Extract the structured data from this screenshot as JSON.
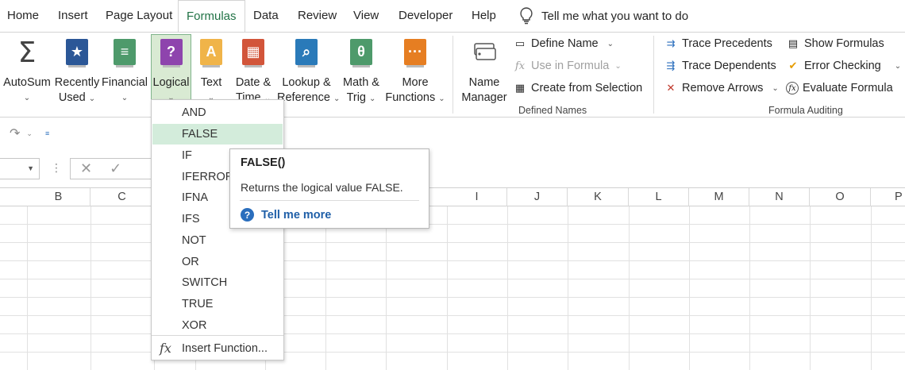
{
  "tabs": [
    "Home",
    "Insert",
    "Page Layout",
    "Formulas",
    "Data",
    "Review",
    "View",
    "Developer",
    "Help"
  ],
  "active_tab": "Formulas",
  "tell_me": "Tell me what you want to do",
  "ribbon": {
    "autosum": "AutoSum",
    "recently_used": [
      "Recently",
      "Used"
    ],
    "financial": "Financial",
    "logical": "Logical",
    "text": "Text",
    "datetime": [
      "Date &",
      "Time"
    ],
    "lookup": [
      "Lookup &",
      "Reference"
    ],
    "math": [
      "Math &",
      "Trig"
    ],
    "more": [
      "More",
      "Functions"
    ],
    "name_manager": [
      "Name",
      "Manager"
    ],
    "define_name": "Define Name",
    "use_in_formula": "Use in Formula",
    "create_from_selection": "Create from Selection",
    "defined_names_group": "Defined Names",
    "trace_precedents": "Trace Precedents",
    "trace_dependents": "Trace Dependents",
    "remove_arrows": "Remove Arrows",
    "show_formulas": "Show Formulas",
    "error_checking": "Error Checking",
    "evaluate_formula": "Evaluate Formula",
    "formula_auditing_group": "Formula Auditing"
  },
  "columns": [
    "B",
    "C",
    "I",
    "J",
    "K",
    "L",
    "M",
    "N",
    "O",
    "P"
  ],
  "menu": {
    "items": [
      "AND",
      "FALSE",
      "IF",
      "IFERROR",
      "IFNA",
      "IFS",
      "NOT",
      "OR",
      "SWITCH",
      "TRUE",
      "XOR"
    ],
    "highlighted": "FALSE",
    "insert_function": "Insert Function..."
  },
  "tooltip": {
    "title": "FALSE()",
    "description": "Returns the logical value FALSE.",
    "tell_me_more": "Tell me more"
  },
  "colors": {
    "accent": "#217346",
    "highlight": "#d3ecdb",
    "link": "#1f5fa8"
  }
}
